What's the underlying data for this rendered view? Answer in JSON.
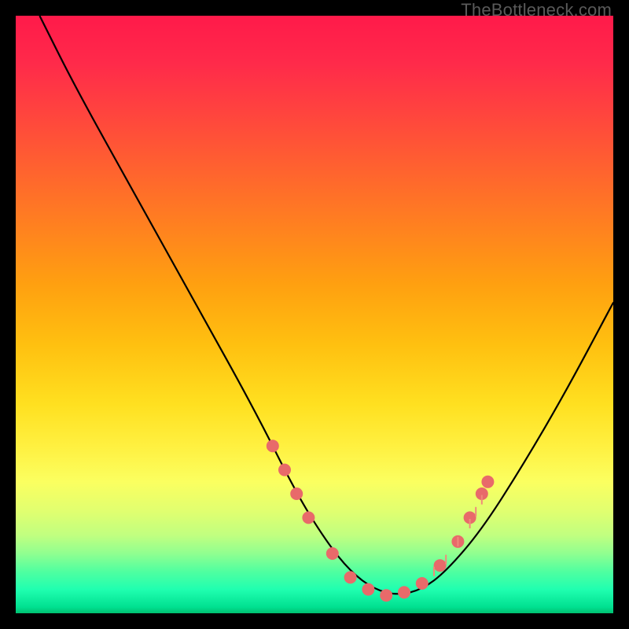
{
  "watermark": "TheBottleneck.com",
  "chart_data": {
    "type": "line",
    "title": "",
    "xlabel": "",
    "ylabel": "",
    "xlim": [
      0,
      100
    ],
    "ylim": [
      0,
      100
    ],
    "series": [
      {
        "name": "bottleneck-curve",
        "x": [
          4,
          10,
          20,
          30,
          40,
          47,
          52,
          56,
          60,
          64,
          68,
          72,
          78,
          85,
          92,
          100
        ],
        "y": [
          100,
          88,
          70,
          52,
          34,
          20,
          12,
          7,
          4,
          3,
          4,
          7,
          14,
          25,
          37,
          52
        ]
      }
    ],
    "markers": {
      "name": "highlight-dots",
      "color": "#e86a6a",
      "points": [
        {
          "x": 43,
          "y": 28
        },
        {
          "x": 45,
          "y": 24
        },
        {
          "x": 47,
          "y": 20
        },
        {
          "x": 49,
          "y": 16
        },
        {
          "x": 53,
          "y": 10
        },
        {
          "x": 56,
          "y": 6
        },
        {
          "x": 59,
          "y": 4
        },
        {
          "x": 62,
          "y": 3
        },
        {
          "x": 65,
          "y": 3.5
        },
        {
          "x": 68,
          "y": 5
        },
        {
          "x": 71,
          "y": 8
        },
        {
          "x": 74,
          "y": 12
        },
        {
          "x": 76,
          "y": 16
        },
        {
          "x": 78,
          "y": 20
        },
        {
          "x": 79,
          "y": 22
        }
      ]
    }
  }
}
